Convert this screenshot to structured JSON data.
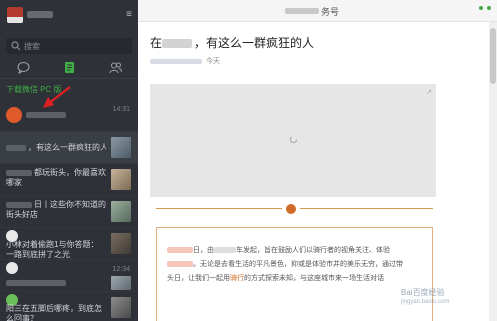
{
  "sidebar": {
    "menu_icon": "≡",
    "search_placeholder": "搜索",
    "tabs": [
      {
        "icon": "chat-bubble-icon"
      },
      {
        "icon": "read-articles-icon"
      },
      {
        "icon": "contacts-icon"
      }
    ],
    "pc_notice": "下载微信 PC 版",
    "chats": [
      {
        "time": "14:31",
        "text": ""
      },
      {
        "time": "",
        "text": "，有这么一群疯狂的人"
      },
      {
        "time": "",
        "text": "都玩街头，你最喜欢哪家"
      },
      {
        "time": "",
        "text": "日丨这些你不知道的街头好店"
      },
      {
        "time": "",
        "text": "小林对着偷跑1与你答题：一路到底拼了之光"
      },
      {
        "time": "12:34",
        "text": ""
      },
      {
        "time": "",
        "text": "阳三在五脚后哪疼，到底怎么回事？"
      }
    ]
  },
  "main": {
    "title_suffix": "务号",
    "article_title": "，有这么一群疯狂的人",
    "article_title_prefix": "在",
    "article_meta_time": "今天",
    "img_corner": "↗",
    "quote_lines": [
      {
        "a": "日，由",
        "b": "车发起，旨在鼓励人们以骑行者的视角关注、体验"
      },
      {
        "a": "。无论是去看生活的平凡景色，抑或是体验市井的美乐无穷，通过带",
        "b": ""
      },
      {
        "a": "头日，让我们一起用",
        "hl": "骑行",
        "b": "的方式探索未知，与这座城市来一场生活对话"
      }
    ],
    "watermark_text": "Bai百度经验",
    "watermark_url": "jingyan.baidu.com"
  },
  "colors": {
    "sidebar_bg": "#2e3238",
    "accent_green": "#3fae45",
    "selected_bg": "#3a3f45",
    "arrow_red": "#e02020",
    "quote_border": "#e2b07a"
  }
}
